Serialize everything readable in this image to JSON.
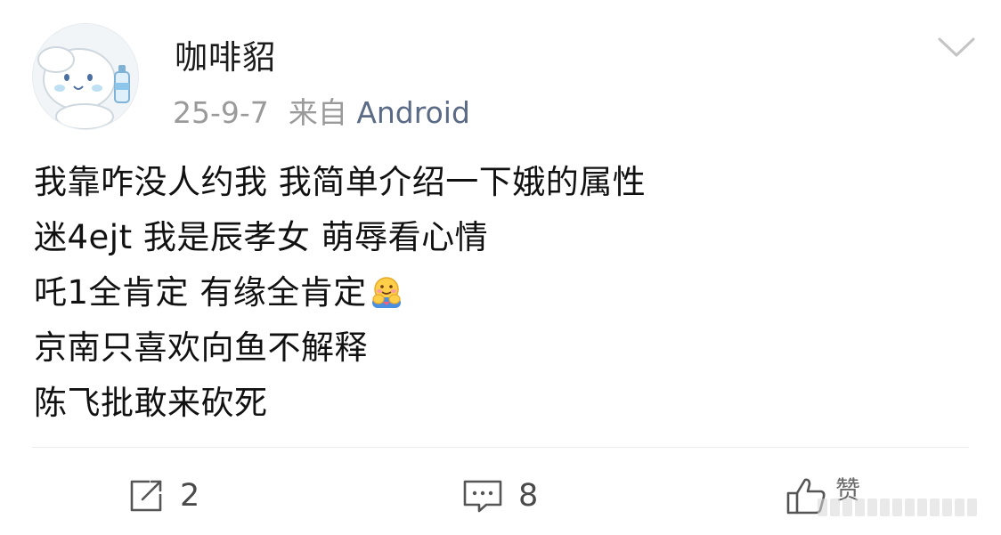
{
  "post": {
    "username": "咖啡貂",
    "date": "25-9-7",
    "source_prefix": "来自",
    "source_app": "Android",
    "lines": [
      "我靠咋没人约我 我简单介绍一下娥的属性",
      "迷4ejt 我是辰孝女 萌辱看心情",
      "吒1全肯定 有缘全肯定",
      "京南只喜欢向鱼不解释",
      "陈飞批敢来砍死"
    ],
    "line3_emoji": "hug-emoji"
  },
  "actions": {
    "share_count": "2",
    "comment_count": "8",
    "like_label": "赞"
  },
  "icons": {
    "share": "share-icon",
    "comment": "comment-icon",
    "like": "thumbs-up-icon",
    "menu": "chevron-down-icon"
  },
  "colors": {
    "source_link": "#5b6b86",
    "meta_gray": "#9a9a9a",
    "text": "#111111"
  }
}
